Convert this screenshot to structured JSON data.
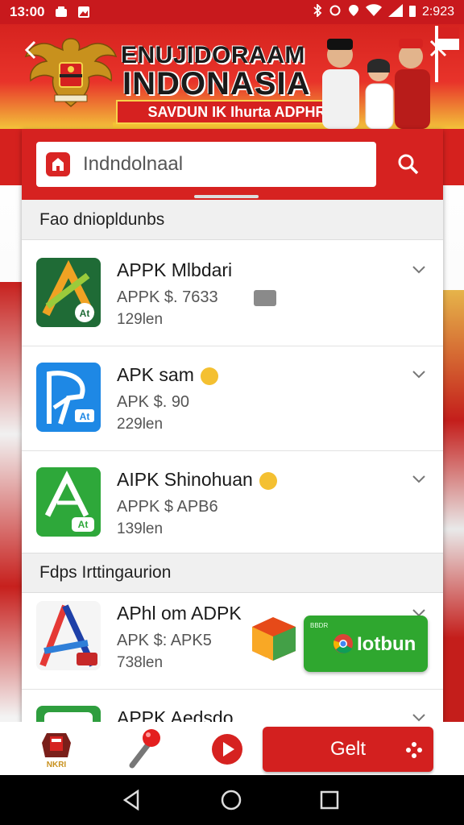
{
  "status_bar": {
    "time": "13:00",
    "right_text": "2:923"
  },
  "banner": {
    "title_line1": "ENUJIDORAAM",
    "title_line2": "INDONASIA",
    "ribbon": "SAVDUN IK Ihurta ADPHR"
  },
  "search": {
    "value": "Indndolnaal"
  },
  "section1": {
    "label": "Fao dniopldunbs"
  },
  "apps": [
    {
      "name": "APPK Mlbdari",
      "price": "APPK $. 7633",
      "size": "129len"
    },
    {
      "name": "APK sam",
      "price": "APK $. 90",
      "size": "229len"
    },
    {
      "name": "AIPK Shinohuan",
      "price": "APPK $ APB6",
      "size": "139len"
    }
  ],
  "section2": {
    "label": "Fdps Irttingaurion"
  },
  "apps2": [
    {
      "name": "APhl om ADPK",
      "price": "APK $: APK5",
      "size": "738len"
    },
    {
      "name": "APPK Aedsdo"
    }
  ],
  "install_button": {
    "label": "Iotbun",
    "tiny": "BBDR"
  },
  "bottom_nav": {
    "get_label": "Gelt",
    "logo_text": "NKRI"
  },
  "colors": {
    "primary_red": "#d62220",
    "green": "#2fa72f",
    "gold": "#f4c232"
  }
}
